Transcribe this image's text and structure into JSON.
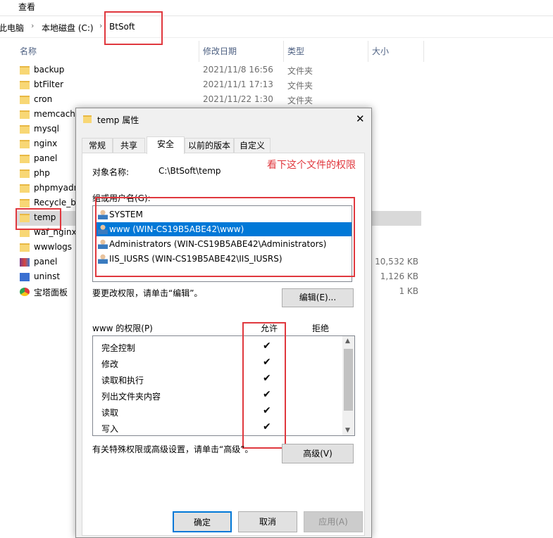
{
  "ribbon": {
    "view_label": "查看"
  },
  "address": {
    "crumbs": [
      "此电脑",
      "本地磁盘 (C:)",
      "BtSoft"
    ],
    "sep": "›"
  },
  "columns": {
    "name": "名称",
    "date": "修改日期",
    "type": "类型",
    "size": "大小"
  },
  "files": [
    {
      "name": "backup",
      "date": "2021/11/8 16:56",
      "type": "文件夹",
      "size": ""
    },
    {
      "name": "btFilter",
      "date": "2021/11/1 17:13",
      "type": "文件夹",
      "size": ""
    },
    {
      "name": "cron",
      "date": "2021/11/22 1:30",
      "type": "文件夹",
      "size": ""
    },
    {
      "name": "memcached",
      "date": "",
      "type": "",
      "size": ""
    },
    {
      "name": "mysql",
      "date": "",
      "type": "",
      "size": ""
    },
    {
      "name": "nginx",
      "date": "",
      "type": "",
      "size": ""
    },
    {
      "name": "panel",
      "date": "",
      "type": "",
      "size": ""
    },
    {
      "name": "php",
      "date": "",
      "type": "",
      "size": ""
    },
    {
      "name": "phpmyadmin",
      "date": "",
      "type": "",
      "size": ""
    },
    {
      "name": "Recycle_bin",
      "date": "",
      "type": "",
      "size": ""
    },
    {
      "name": "temp",
      "date": "",
      "type": "",
      "size": ""
    },
    {
      "name": "waf_nginx",
      "date": "",
      "type": "",
      "size": ""
    },
    {
      "name": "wwwlogs",
      "date": "",
      "type": "",
      "size": ""
    },
    {
      "name": "panel",
      "date": "",
      "type": "",
      "size": "10,532 KB"
    },
    {
      "name": "uninst",
      "date": "",
      "type": "",
      "size": "1,126 KB"
    },
    {
      "name": "宝塔面板",
      "date": "",
      "type": "",
      "size": "1 KB"
    }
  ],
  "dialog": {
    "title": "temp 属性",
    "close": "✕",
    "tabs": [
      "常规",
      "共享",
      "安全",
      "以前的版本",
      "自定义"
    ],
    "object_label": "对象名称:",
    "object_value": "C:\\BtSoft\\temp",
    "annotation": "看下这个文件的权限",
    "groups_label": "组或用户名(G):",
    "groups": [
      "SYSTEM",
      "www (WIN-CS19B5ABE42\\www)",
      "Administrators (WIN-CS19B5ABE42\\Administrators)",
      "IIS_IUSRS (WIN-CS19B5ABE42\\IIS_IUSRS)"
    ],
    "change_hint": "要更改权限，请单击“编辑”。",
    "edit_button": "编辑(E)...",
    "perm_title": "www 的权限(P)",
    "allow": "允许",
    "deny": "拒绝",
    "permissions": [
      "完全控制",
      "修改",
      "读取和执行",
      "列出文件夹内容",
      "读取",
      "写入"
    ],
    "check": "✔",
    "advanced_hint": "有关特殊权限或高级设置，请单击“高级”。",
    "advanced_button": "高级(V)",
    "ok": "确定",
    "cancel": "取消",
    "apply": "应用(A)"
  }
}
